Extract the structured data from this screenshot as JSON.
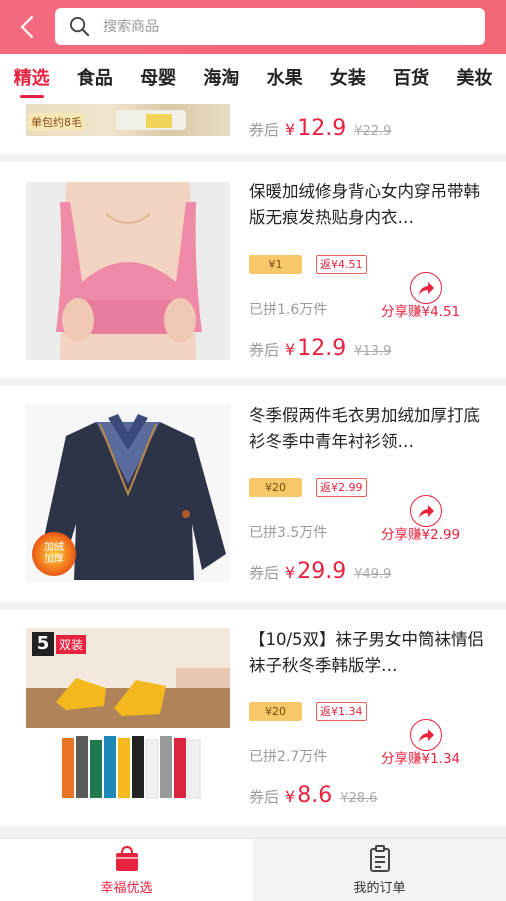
{
  "header": {
    "search_placeholder": "搜索商品"
  },
  "tabs": [
    "精选",
    "食品",
    "母婴",
    "海淘",
    "水果",
    "女装",
    "百货",
    "美妆"
  ],
  "active_tab": 0,
  "partial_item": {
    "thumb_text": "单包约8毛",
    "price_label": "券后",
    "currency": "¥",
    "price": "12.9",
    "original_price": "¥22.9"
  },
  "products": [
    {
      "title": "保暖加绒修身背心女内穿吊带韩版无痕发热贴身内衣…",
      "coupon": "¥1",
      "rebate": "返¥4.51",
      "sold": "已拼1.6万件",
      "share_earn": "分享赚¥4.51",
      "price_label": "券后",
      "currency": "¥",
      "price": "12.9",
      "original_price": "¥13.9"
    },
    {
      "title": "冬季假两件毛衣男加绒加厚打底衫冬季中青年衬衫领…",
      "coupon": "¥20",
      "rebate": "返¥2.99",
      "sold": "已拼3.5万件",
      "share_earn": "分享赚¥2.99",
      "price_label": "券后",
      "currency": "¥",
      "price": "29.9",
      "original_price": "¥49.9",
      "badge_text": "加绒\n加厚"
    },
    {
      "title": "【10/5双】袜子男女中筒袜情侣袜子秋冬季韩版学…",
      "coupon": "¥20",
      "rebate": "返¥1.34",
      "sold": "已拼2.7万件",
      "share_earn": "分享赚¥1.34",
      "price_label": "券后",
      "currency": "¥",
      "price": "8.6",
      "original_price": "¥28.6",
      "pack_number": "5",
      "pack_text": "双装"
    }
  ],
  "bottom_nav": [
    {
      "label": "幸福优选",
      "icon": "shopping-bag-icon",
      "active": true
    },
    {
      "label": "我的订单",
      "icon": "order-list-icon",
      "active": false
    }
  ],
  "colors": {
    "brand_red": "#e8233f",
    "header_pink": "#f5677c",
    "coupon_gold": "#f7c86a"
  }
}
